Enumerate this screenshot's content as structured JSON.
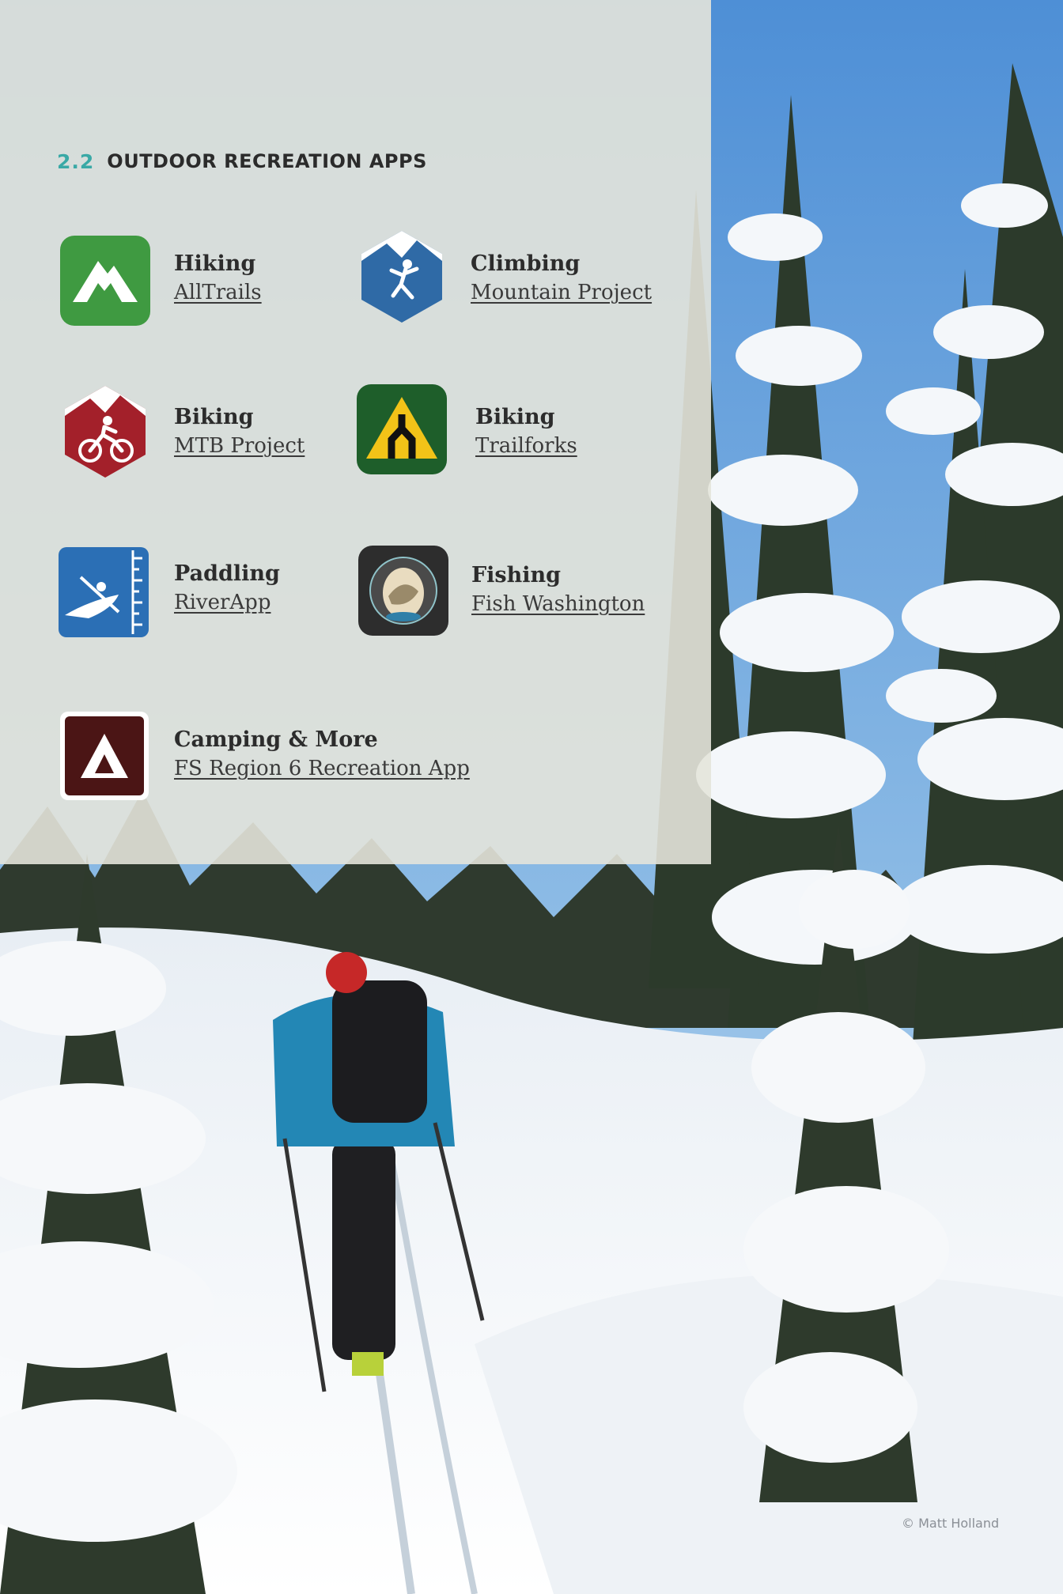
{
  "section": {
    "number": "2.2",
    "title": "OUTDOOR RECREATION APPS"
  },
  "apps": [
    {
      "category": "Hiking",
      "link": "AllTrails",
      "icon": "alltrails-mountain-icon",
      "color": "#3f9a41"
    },
    {
      "category": "Climbing",
      "link": "Mountain Project",
      "icon": "mountain-project-climber-icon",
      "color": "#2f6aa6"
    },
    {
      "category": "Biking",
      "link": "MTB Project",
      "icon": "mtb-project-biker-icon",
      "color": "#a3202a"
    },
    {
      "category": "Biking",
      "link": "Trailforks",
      "icon": "trailforks-fork-icon",
      "color": "#1e5e2a"
    },
    {
      "category": "Paddling",
      "link": "RiverApp",
      "icon": "riverapp-kayak-icon",
      "color": "#2b6fb5"
    },
    {
      "category": "Fishing",
      "link": "Fish Washington",
      "icon": "fish-washington-trout-icon",
      "color": "#2d2d2d"
    },
    {
      "category": "Camping & More",
      "link": "FS Region 6 Recreation App",
      "icon": "camping-tent-icon",
      "color": "#4b1515"
    }
  ],
  "credit": "© Matt Holland",
  "colors": {
    "accent": "#3aa9a6",
    "panel": "#e4e4da",
    "text": "#2c2c2c"
  }
}
